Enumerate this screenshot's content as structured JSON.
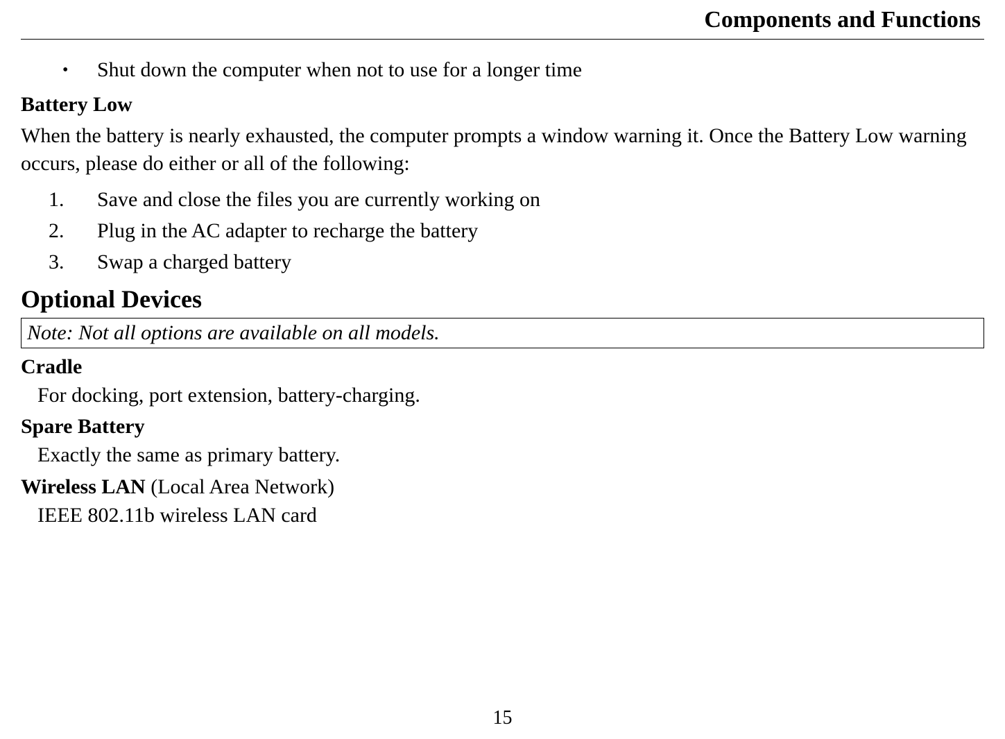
{
  "header": {
    "title": "Components and Functions"
  },
  "bullet": {
    "item1": "Shut down the computer when not to use for a longer time"
  },
  "batteryLow": {
    "heading": "Battery Low",
    "paragraph": "When the battery is nearly exhausted, the computer prompts a window warning it. Once the Battery Low warning occurs, please do either or all of the following:",
    "steps": {
      "s1": "Save and close the files you are currently working on",
      "s2": "Plug in the AC adapter to recharge the battery",
      "s3": "Swap a charged battery"
    }
  },
  "optionalDevices": {
    "heading": "Optional Devices",
    "note": "Note: Not all options are available on all models.",
    "cradle": {
      "heading": "Cradle",
      "body": "For docking, port extension, battery-charging."
    },
    "spareBattery": {
      "heading": "Spare Battery",
      "body": "Exactly the same as primary battery."
    },
    "wirelessLan": {
      "heading": "Wireless LAN",
      "paren": " (Local Area Network)",
      "body": "IEEE 802.11b wireless LAN card"
    }
  },
  "pageNumber": "15"
}
